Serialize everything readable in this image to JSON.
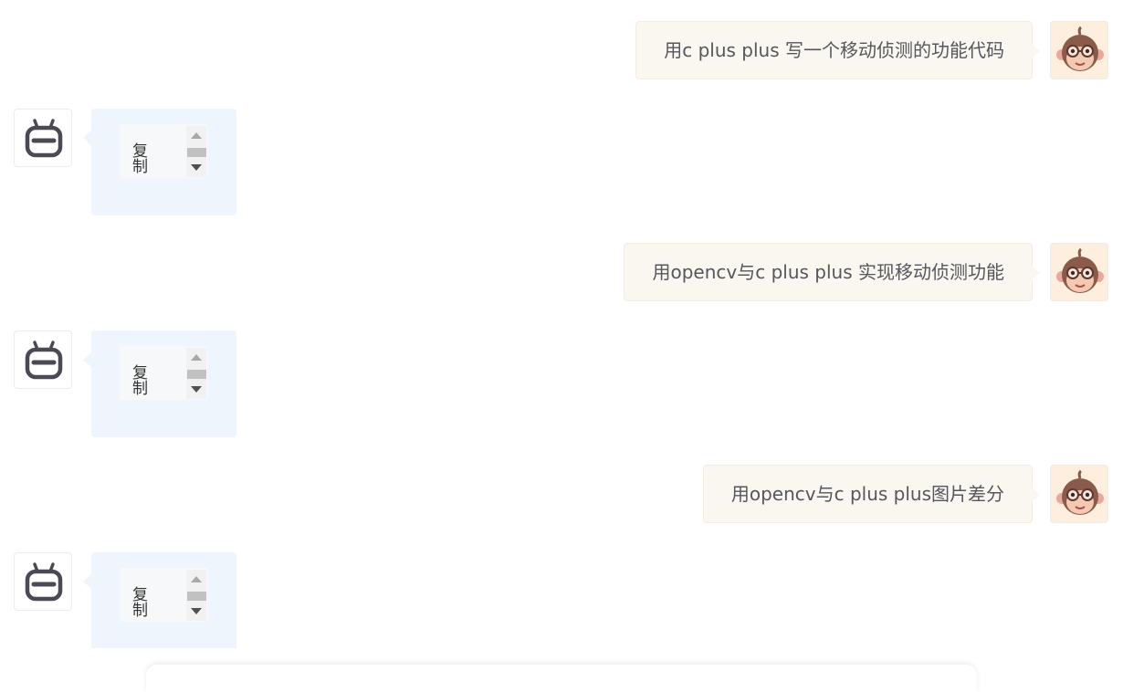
{
  "conversation": {
    "messages": [
      {
        "role": "user",
        "text": "用c plus plus 写一个移动侦测的功能代码"
      },
      {
        "role": "assistant",
        "copy_label": "复制"
      },
      {
        "role": "user",
        "text": "用opencv与c plus plus 实现移动侦测功能"
      },
      {
        "role": "assistant",
        "copy_label": "复制"
      },
      {
        "role": "user",
        "text": "用opencv与c plus plus图片差分"
      },
      {
        "role": "assistant",
        "copy_label": "复制"
      }
    ]
  },
  "icons": {
    "user_avatar": "monkey-with-glasses-icon",
    "bot_avatar": "robot-icon",
    "scroll_up": "triangle-up-icon",
    "scroll_down": "triangle-down-icon"
  },
  "colors": {
    "user_bubble": "#faf7f0",
    "bot_bubble": "#eef5fc",
    "text": "#55575d"
  }
}
